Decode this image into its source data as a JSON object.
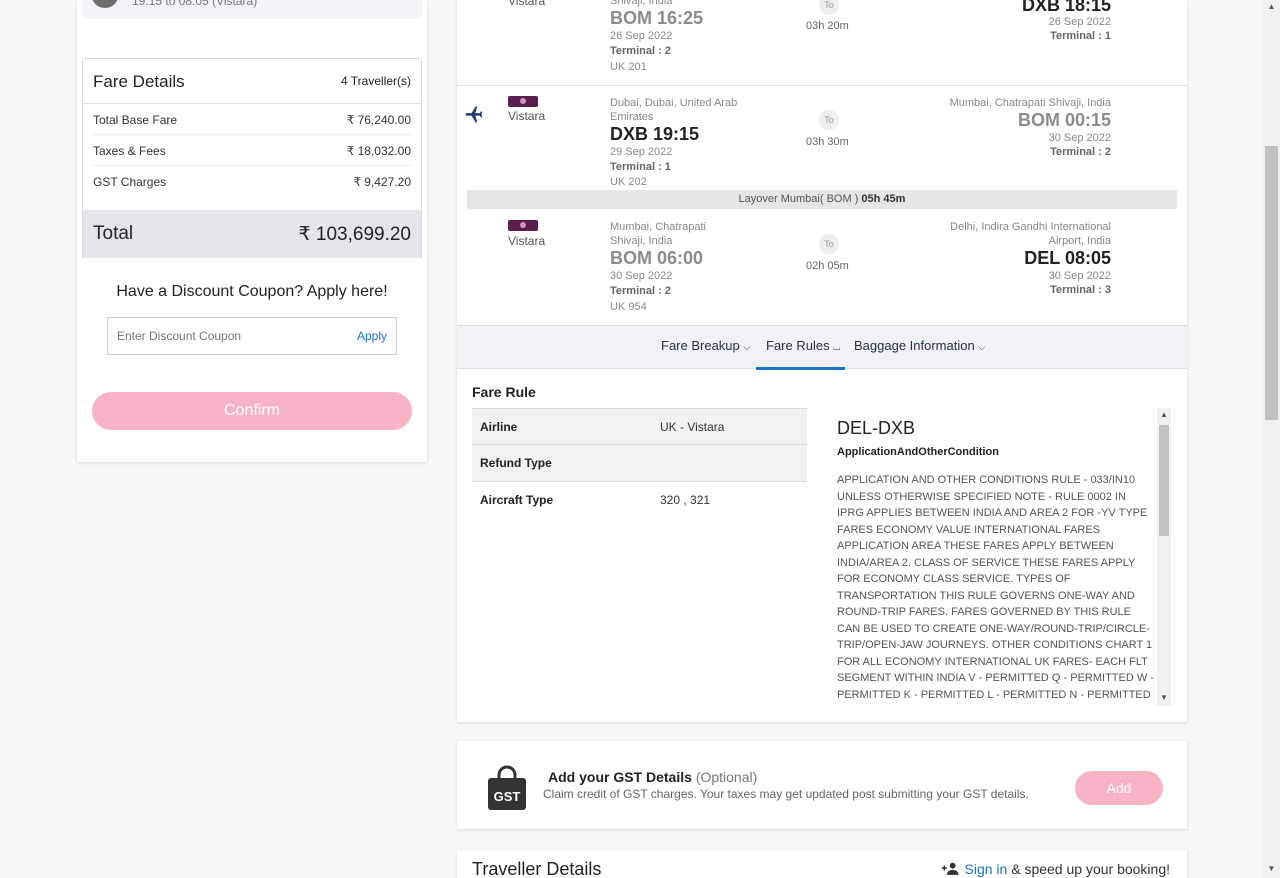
{
  "itinerary_top": {
    "text": "19:15 to 08:05 (Vistara)"
  },
  "fare_details": {
    "title": "Fare Details",
    "travellers": "4 Traveller(s)",
    "rows": [
      {
        "label": "Total Base Fare",
        "value": "₹ 76,240.00"
      },
      {
        "label": "Taxes & Fees",
        "value": "₹ 18,032.00"
      },
      {
        "label": "GST Charges",
        "value": "₹ 9,427.20"
      }
    ],
    "total_label": "Total",
    "total_value": "₹ 103,699.20"
  },
  "coupon": {
    "title": "Have a Discount Coupon? Apply here!",
    "placeholder": "Enter Discount Coupon",
    "apply_label": "Apply"
  },
  "confirm_label": "Confirm",
  "segments": {
    "seg0": {
      "airline": "Vistara",
      "dep_city": "Shivaji, India",
      "dep_time": "BOM 16:25",
      "dep_date": "26 Sep 2022",
      "dep_terminal": "Terminal : 2",
      "flight_no": "UK 201",
      "to_label": "To",
      "duration": "03h 20m",
      "arr_time": "DXB 18:15",
      "arr_date": "26 Sep 2022",
      "arr_terminal": "Terminal : 1"
    },
    "seg1": {
      "airline": "Vistara",
      "dep_city": "Dubai, Dubai, United Arab Emirates",
      "dep_time": "DXB 19:15",
      "dep_date": "29 Sep 2022",
      "dep_terminal": "Terminal : 1",
      "flight_no": "UK 202",
      "to_label": "To",
      "duration": "03h 30m",
      "arr_city": "Mumbai, Chatrapati Shivaji, India",
      "arr_time": "BOM 00:15",
      "arr_date": "30 Sep 2022",
      "arr_terminal": "Terminal : 2"
    },
    "layover_prefix": "Layover Mumbai( BOM ) ",
    "layover_duration": "05h 45m",
    "seg2": {
      "airline": "Vistara",
      "dep_city": "Mumbai, Chatrapati Shivaji, India",
      "dep_time": "BOM 06:00",
      "dep_date": "30 Sep 2022",
      "dep_terminal": "Terminal : 2",
      "flight_no": "UK 954",
      "to_label": "To",
      "duration": "02h 05m",
      "arr_city": "Delhi, Indira Gandhi International Airport, India",
      "arr_time": "DEL 08:05",
      "arr_date": "30 Sep 2022",
      "arr_terminal": "Terminal : 3"
    }
  },
  "tabs": [
    {
      "label": "Fare Breakup"
    },
    {
      "label": "Fare Rules"
    },
    {
      "label": "Baggage Information"
    }
  ],
  "active_tab": "Fare Rules",
  "fare_rule": {
    "title": "Fare Rule",
    "rows": [
      {
        "key": "Airline",
        "value": "UK - Vistara"
      },
      {
        "key": "Refund Type",
        "value": ""
      },
      {
        "key": "Aircraft Type",
        "value": "320 , 321"
      }
    ],
    "route": "DEL-DXB",
    "section": "ApplicationAndOtherCondition",
    "text": "APPLICATION AND OTHER CONDITIONS RULE - 033/IN10 UNLESS OTHERWISE SPECIFIED NOTE - RULE 0002 IN IPRG APPLIES BETWEEN INDIA AND AREA 2 FOR -YV TYPE FARES ECONOMY VALUE INTERNATIONAL FARES APPLICATION AREA THESE FARES APPLY BETWEEN INDIA/AREA 2. CLASS OF SERVICE THESE FARES APPLY FOR ECONOMY CLASS SERVICE. TYPES OF TRANSPORTATION THIS RULE GOVERNS ONE-WAY AND ROUND-TRIP FARES. FARES GOVERNED BY THIS RULE CAN BE USED TO CREATE ONE-WAY/ROUND-TRIP/CIRCLE-TRIP/OPEN-JAW JOURNEYS. OTHER CONDITIONS CHART 1 FOR ALL ECONOMY INTERNATIONAL UK FARES- EACH FLT SEGMENT WITHIN INDIA V - PERMITTED Q - PERMITTED W - PERMITTED K - PERMITTED L - PERMITTED N - PERMITTED H - REQUIRED. ------------------------------------------------ SCHEDULE IS SUBJECT TO REGULATORY APPROVAL"
  },
  "gst": {
    "icon_text": "GST",
    "title": "Add your GST Details",
    "optional": "(Optional)",
    "description": "Claim credit of GST charges. Your taxes may get updated post submitting your GST details.",
    "add_label": "Add"
  },
  "traveller": {
    "title": "Traveller Details",
    "signin_label": "Sign in",
    "signin_suffix": " & speed up your booking!"
  },
  "colors": {
    "accent": "#1a73c8",
    "button_pink": "#f8b4c4",
    "airline_purple": "#5b1f4f"
  }
}
